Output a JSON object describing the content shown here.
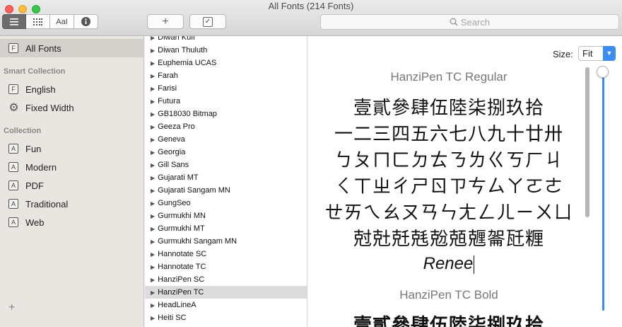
{
  "window": {
    "title": "All Fonts (214 Fonts)"
  },
  "toolbar": {
    "aa_label": "AaI",
    "add_symbol": "+",
    "check_symbol": "✓"
  },
  "search": {
    "placeholder": "Search"
  },
  "sidebar": {
    "all_fonts": {
      "icon_letter": "F",
      "label": "All Fonts"
    },
    "smart_heading": "Smart Collection",
    "smart_items": [
      {
        "icon_letter": "F",
        "label": "English"
      },
      {
        "icon": "gear-icon",
        "label": "Fixed Width"
      }
    ],
    "collection_heading": "Collection",
    "collections": [
      {
        "icon_letter": "A",
        "label": "Fun"
      },
      {
        "icon_letter": "A",
        "label": "Modern"
      },
      {
        "icon_letter": "A",
        "label": "PDF"
      },
      {
        "icon_letter": "A",
        "label": "Traditional"
      },
      {
        "icon_letter": "A",
        "label": "Web"
      }
    ],
    "add_symbol": "+"
  },
  "font_list": {
    "selected": "HanziPen TC",
    "items": [
      "Diwan Kufi",
      "Diwan Thuluth",
      "Euphemia UCAS",
      "Farah",
      "Farisi",
      "Futura",
      "GB18030 Bitmap",
      "Geeza Pro",
      "Geneva",
      "Georgia",
      "Gill Sans",
      "Gujarati MT",
      "Gujarati Sangam MN",
      "GungSeo",
      "Gurmukhi MN",
      "Gurmukhi MT",
      "Gurmukhi Sangam MN",
      "Hannotate SC",
      "Hannotate TC",
      "HanziPen SC",
      "HanziPen TC",
      "HeadLineA",
      "Heiti SC"
    ]
  },
  "preview": {
    "size_label": "Size:",
    "size_value": "Fit",
    "regular_title": "HanziPen TC Regular",
    "lines": [
      "壹貳參肆伍陸柒捌玖拾",
      "一二三四五六七八九十廿卅",
      "ㄅㄆㄇㄈㄉㄊㄋㄌㄍㄎㄏㄐ",
      "ㄑㄒㄓㄔㄕㄖㄗㄘㄙㄚㄛㄜ",
      "ㄝㄞㄟㄠㄡㄢㄣㄤㄥㄦㄧㄨㄩ",
      "尅兙兛兞兝兡兣嗧瓩糎"
    ],
    "typed_text": "Renee",
    "bold_title": "HanziPen TC Bold",
    "bold_partial": "壹貳參肆伍陸柒捌玖拾"
  }
}
